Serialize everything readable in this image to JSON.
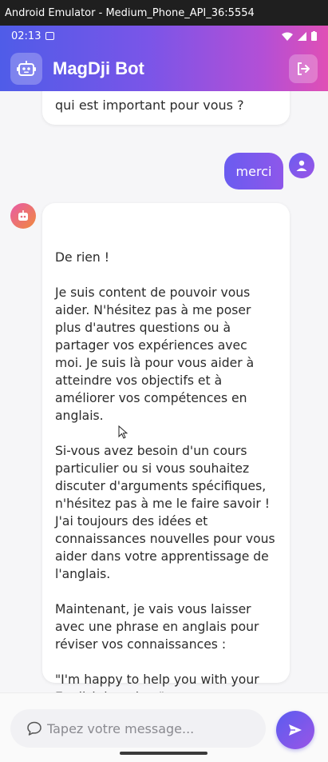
{
  "window": {
    "title": "Android Emulator - Medium_Phone_API_36:5554"
  },
  "status_bar": {
    "time": "02:13"
  },
  "app_bar": {
    "title": "MagDji Bot"
  },
  "colors": {
    "gradient_start": "#4f5ce8",
    "gradient_end": "#e04fb5",
    "accent": "#6a5cf0"
  },
  "chat": {
    "previous_bot_tail": "qui est important pour vous ?",
    "user_message": "merci",
    "bot_message": "De rien !\n\nJe suis content de pouvoir vous aider. N'hésitez pas à me poser plus d'autres questions ou à partager vos expériences avec moi. Je suis là pour vous aider à atteindre vos objectifs et à améliorer vos compétences en anglais.\n\nSi-vous avez besoin d'un cours particulier ou si vous souhaitez discuter d'arguments spécifiques, n'hésitez pas à me le faire savoir ! J'ai toujours des idées et connaissances nouvelles pour vous aider dans votre apprentissage de l'anglais.\n\nMaintenant, je vais vous laisser avec une phrase en anglais pour réviser vos connaissances :\n\n\"I'm happy to help you with your English learning.\"\n\nJe vais bien, à bientôt !"
  },
  "input": {
    "placeholder": "Tapez votre message...",
    "value": ""
  },
  "icons": {
    "logo": "robot-icon",
    "logout": "logout-icon",
    "user_avatar": "person-icon",
    "bot_avatar": "robot-icon",
    "input": "chat-bubble-icon",
    "send": "send-icon"
  }
}
